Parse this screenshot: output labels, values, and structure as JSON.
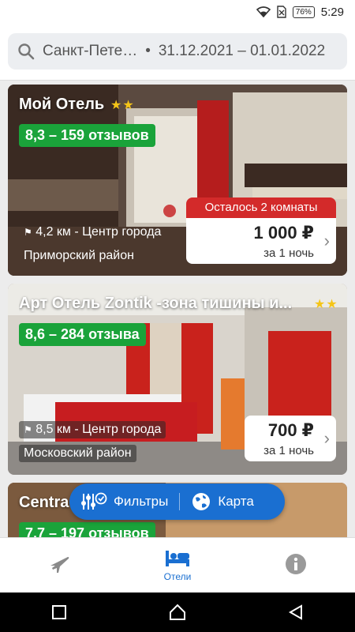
{
  "status_bar": {
    "time": "5:29",
    "battery": "76%"
  },
  "search": {
    "city": "Санкт-Пете…",
    "separator": "•",
    "dates": "31.12.2021 – 01.01.2022"
  },
  "hotels": [
    {
      "name": "Мой Отель",
      "stars": "★★",
      "rating": "8,3 – 159 отзывов",
      "distance": "4,2 км - Центр города",
      "district": "Приморский район",
      "rooms_left": "Осталось 2 комнаты",
      "price": "1 000 ₽",
      "per_night": "за 1 ночь"
    },
    {
      "name": "Арт Отель Zontik -зона тишины и...",
      "stars": "★★",
      "rating": "8,6 – 284 отзыва",
      "distance": "8,5 км - Центр города",
      "district": "Московский район",
      "price": "700 ₽",
      "per_night": "за 1 ночь"
    },
    {
      "name": "Centra",
      "rating": "7,7 – 197 отзывов"
    }
  ],
  "fab": {
    "filters": "Фильтры",
    "map": "Карта"
  },
  "tabs": {
    "flights": "",
    "hotels": "Отели",
    "info": ""
  },
  "colors": {
    "accent": "#1a6fd1",
    "rating_green": "#1aa33a",
    "alert_red": "#d32a2a",
    "star": "#f5c518"
  }
}
